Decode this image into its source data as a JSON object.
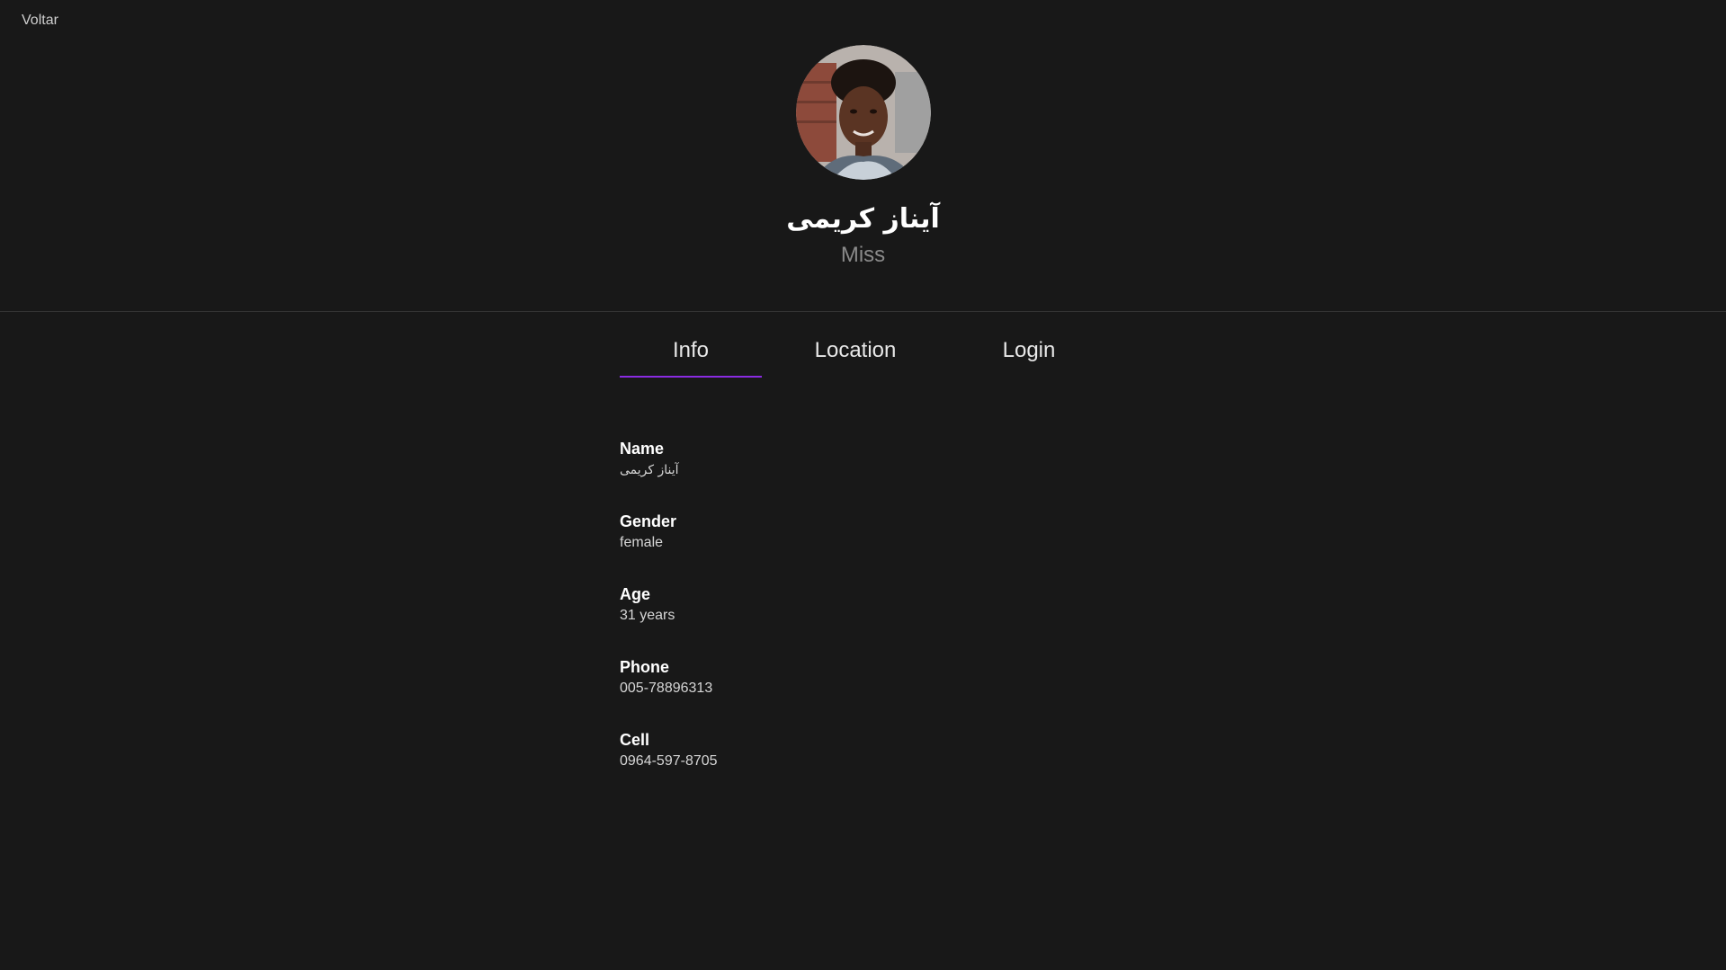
{
  "nav": {
    "back_label": "Voltar"
  },
  "profile": {
    "name": "آیناز کریمی",
    "title": "Miss"
  },
  "tabs": [
    {
      "label": "Info",
      "active": true
    },
    {
      "label": "Location",
      "active": false
    },
    {
      "label": "Login",
      "active": false
    }
  ],
  "info": {
    "name": {
      "label": "Name",
      "value": "آیناز کریمی"
    },
    "gender": {
      "label": "Gender",
      "value": "female"
    },
    "age": {
      "label": "Age",
      "value": "31 years"
    },
    "phone": {
      "label": "Phone",
      "value": "005-78896313"
    },
    "cell": {
      "label": "Cell",
      "value": "0964-597-8705"
    }
  },
  "colors": {
    "background": "#181818",
    "accent": "#8a2be2",
    "muted_text": "#8a8a8a"
  }
}
